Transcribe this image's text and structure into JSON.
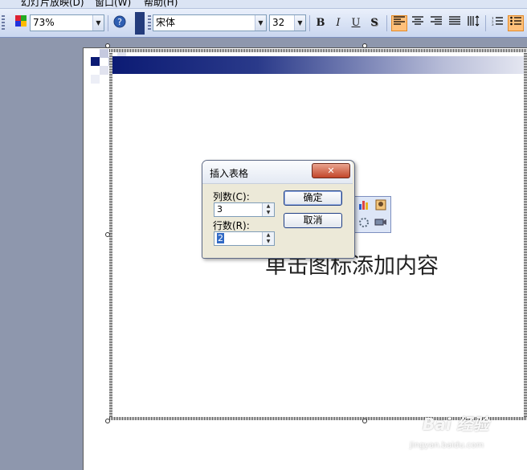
{
  "menu": {
    "items": [
      "幻灯片放映(D)",
      "窗口(W)",
      "帮助(H)"
    ]
  },
  "toolbar": {
    "zoom": "73%",
    "font_name": "宋体",
    "font_size": "32",
    "bold": "B",
    "italic": "I",
    "underline": "U",
    "shadow": "S",
    "help_icon": "?"
  },
  "slide": {
    "placeholder_text": "单击图标添加内容"
  },
  "dialog": {
    "title": "插入表格",
    "close": "✕",
    "columns_label": "列数(C):",
    "columns_value": "3",
    "rows_label": "行数(R):",
    "rows_value": "2",
    "ok_label": "确定",
    "cancel_label": "取消"
  },
  "watermark": {
    "text": "Bai 经验",
    "url": "jingyan.baidu.com"
  }
}
